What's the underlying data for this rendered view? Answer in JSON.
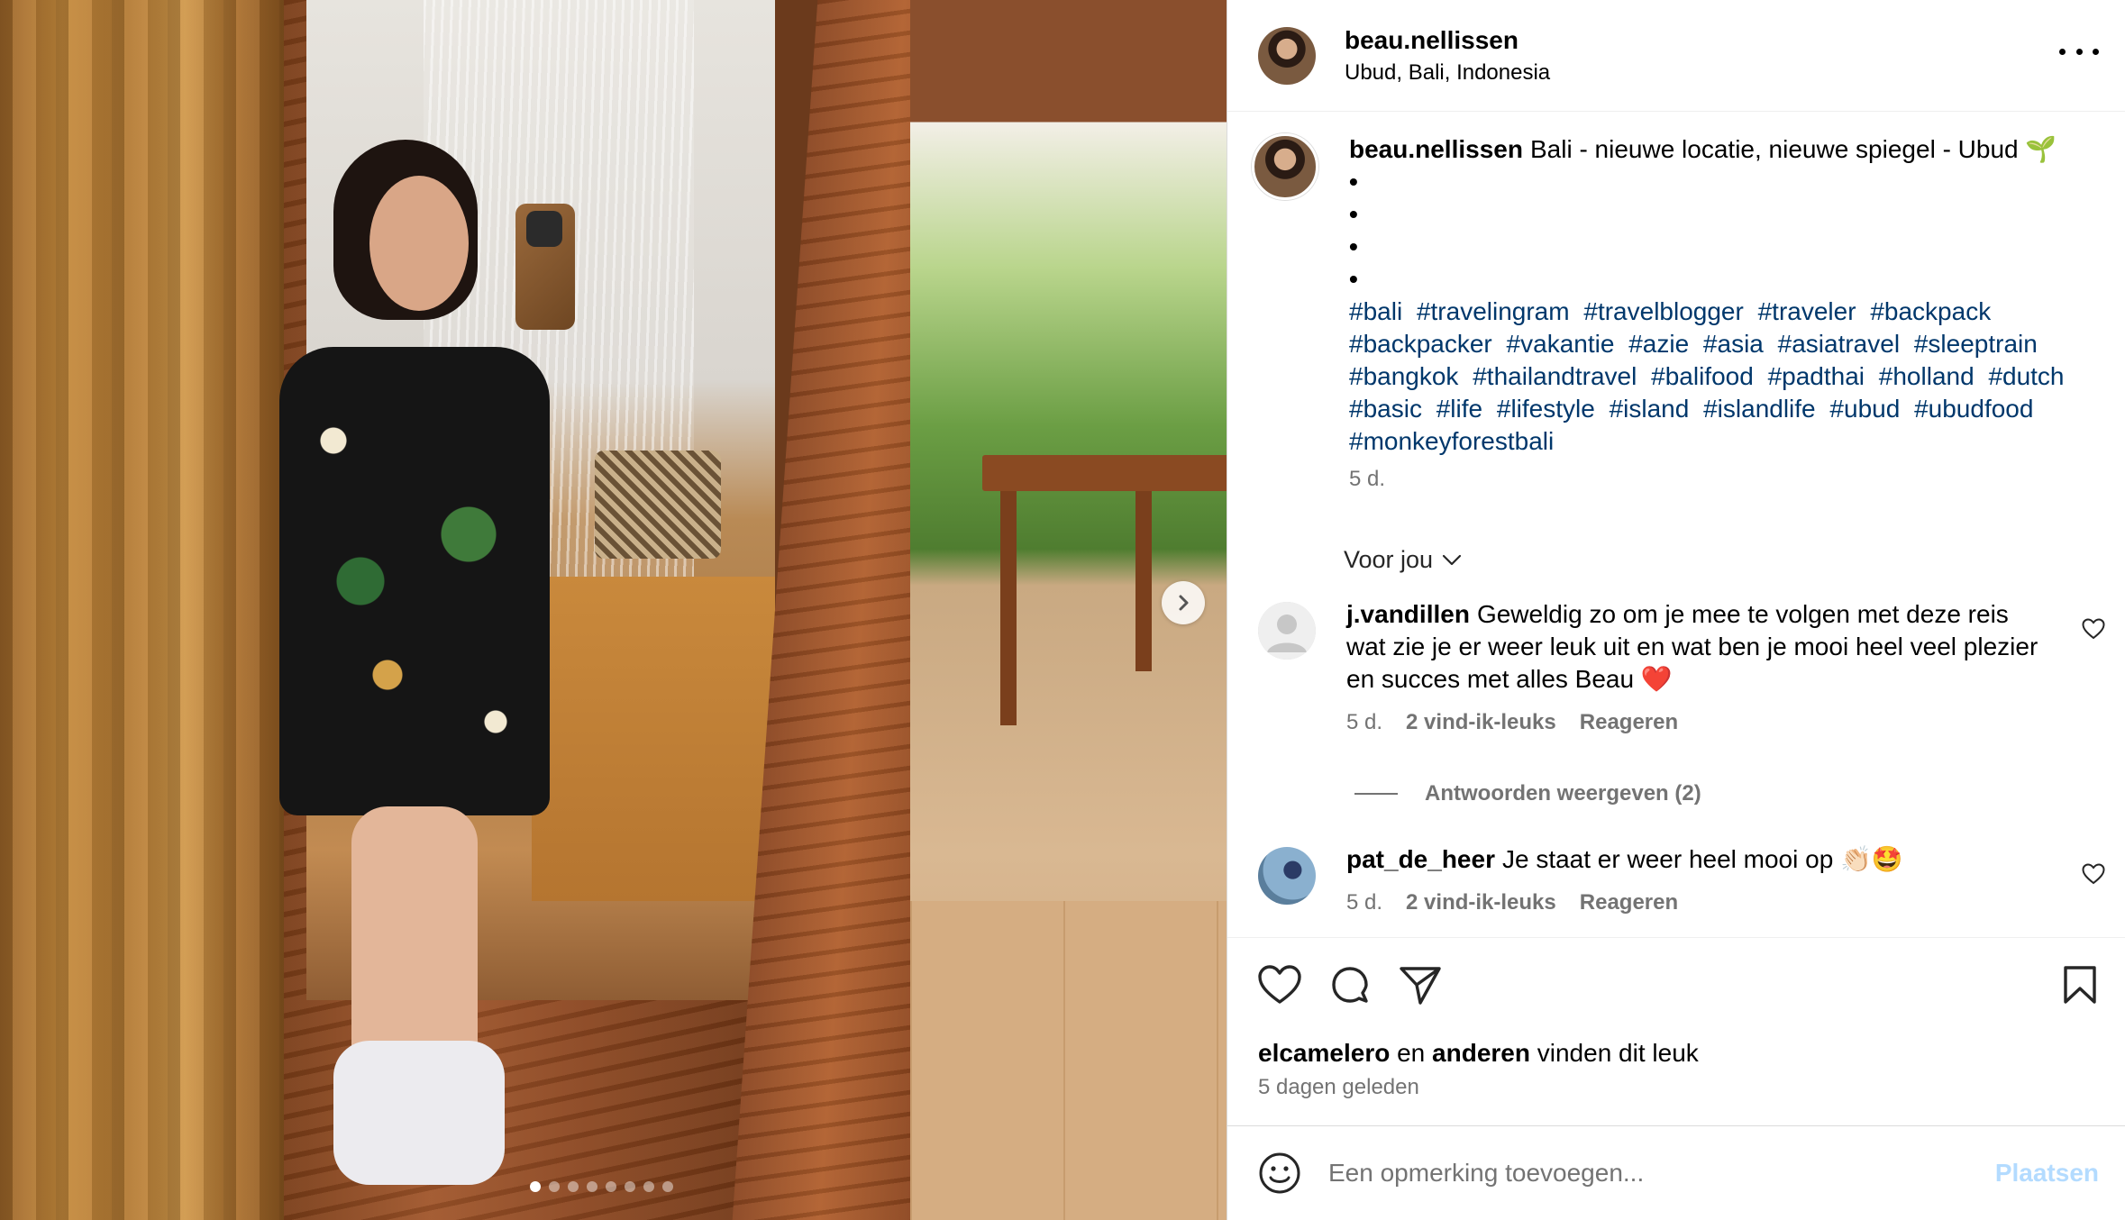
{
  "post": {
    "username": "beau.nellissen",
    "location": "Ubud, Bali, Indonesia",
    "caption_text": "Bali - nieuwe locatie, nieuwe spiegel - Ubud 🌱",
    "bullets": [
      "•",
      "•",
      "•",
      "•"
    ],
    "hashtags": [
      "#bali",
      "#travelingram",
      "#travelblogger",
      "#traveler",
      "#backpack",
      "#backpacker",
      "#vakantie",
      "#azie",
      "#asia",
      "#asiatravel",
      "#sleeptrain",
      "#bangkok",
      "#thailandtravel",
      "#balifood",
      "#padthai",
      "#holland",
      "#dutch",
      "#basic",
      "#life",
      "#lifestyle",
      "#island",
      "#islandlife",
      "#ubud",
      "#ubudfood",
      "#monkeyforestbali"
    ],
    "caption_time": "5 d.",
    "carousel": {
      "count": 8,
      "active": 1
    }
  },
  "filter": {
    "label": "Voor jou"
  },
  "comments": [
    {
      "username": "j.vandillen",
      "text": "Geweldig zo om je mee te volgen met deze reis wat zie je er weer leuk uit en wat ben je mooi heel veel plezier en succes met alles Beau ❤️",
      "time": "5 d.",
      "likes": "2 vind-ik-leuks",
      "reply": "Reageren"
    },
    {
      "username": "pat_de_heer",
      "text": "Je staat er weer heel mooi op 👏🏻🤩",
      "time": "5 d.",
      "likes": "2 vind-ik-leuks",
      "reply": "Reageren"
    }
  ],
  "view_replies": "Antwoorden weergeven (2)",
  "likes": {
    "user": "elcamelero",
    "and": "en",
    "others": "anderen",
    "suffix": "vinden dit leuk"
  },
  "date": "5 dagen geleden",
  "comment_input": {
    "placeholder": "Een opmerking toevoegen...",
    "post_label": "Plaatsen"
  },
  "colors": {
    "hashtag": "#00376b",
    "secondary": "#737373",
    "post_disabled": "#b3dbff"
  }
}
